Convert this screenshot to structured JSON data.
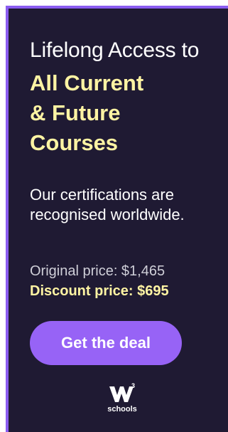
{
  "ad": {
    "headline_line1": "Lifelong Access to",
    "headline_line2": "All Current",
    "headline_line3": "& Future",
    "headline_line4": "Courses",
    "subtitle": "Our certifications are recognised worldwide.",
    "original_price": "Original price: $1,465",
    "discount_price": "Discount price: $695",
    "cta_label": "Get the deal",
    "logo_text": "schools",
    "logo_superscript": "3",
    "logo_icon": "w3schools-logo-icon"
  },
  "colors": {
    "background": "#1f1a33",
    "border_accent": "#8a5cf0",
    "highlight": "#fff4a3",
    "button": "#9763f6"
  }
}
